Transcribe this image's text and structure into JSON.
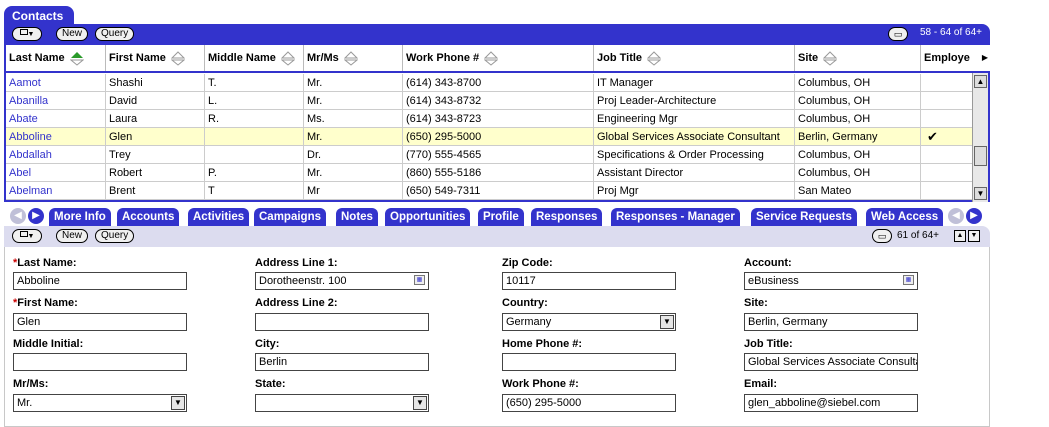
{
  "app": {
    "main_tab": "Contacts"
  },
  "list": {
    "new_label": "New",
    "query_label": "Query",
    "record_count": "58 - 64 of 64+",
    "columns": [
      "Last Name",
      "First Name",
      "Middle Name",
      "Mr/Ms",
      "Work Phone #",
      "Job Title",
      "Site",
      "Employe"
    ],
    "rows": [
      [
        "Aamot",
        "Shashi",
        "T.",
        "Mr.",
        "(614) 343-8700",
        "IT Manager",
        "Columbus, OH",
        ""
      ],
      [
        "Abanilla",
        "David",
        "L.",
        "Mr.",
        "(614) 343-8732",
        "Proj Leader-Architecture",
        "Columbus, OH",
        ""
      ],
      [
        "Abate",
        "Laura",
        "R.",
        "Ms.",
        "(614) 343-8723",
        "Engineering Mgr",
        "Columbus, OH",
        ""
      ],
      [
        "Abboline",
        "Glen",
        "",
        "Mr.",
        "(650) 295-5000",
        "Global Services Associate Consultant",
        "Berlin, Germany",
        "✔"
      ],
      [
        "Abdallah",
        "Trey",
        "",
        "Dr.",
        "(770) 555-4565",
        "Specifications & Order Processing",
        "Columbus, OH",
        ""
      ],
      [
        "Abel",
        "Robert",
        "P.",
        "Mr.",
        "(860) 555-5186",
        "Assistant Director",
        "Columbus, OH",
        ""
      ],
      [
        "Abelman",
        "Brent",
        "T",
        "Mr",
        "(650) 549-7311",
        "Proj Mgr",
        "San Mateo",
        ""
      ]
    ]
  },
  "tabs": [
    "More Info",
    "Accounts",
    "Activities",
    "Campaigns",
    "Notes",
    "Opportunities",
    "Profile",
    "Responses",
    "Responses - Manager",
    "Service Requests",
    "Web Access"
  ],
  "form": {
    "new_label": "New",
    "query_label": "Query",
    "record_count": "61 of 64+",
    "last_name_label": "Last Name:",
    "last_name": "Abboline",
    "first_name_label": "First Name:",
    "first_name": "Glen",
    "middle_initial_label": "Middle Initial:",
    "middle_initial": "",
    "mr_ms_label": "Mr/Ms:",
    "mr_ms": "Mr.",
    "address1_label": "Address Line 1:",
    "address1": "Dorotheenstr. 100",
    "address2_label": "Address Line 2:",
    "address2": "",
    "city_label": "City:",
    "city": "Berlin",
    "state_label": "State:",
    "state": "",
    "zip_label": "Zip Code:",
    "zip": "10117",
    "country_label": "Country:",
    "country": "Germany",
    "home_phone_label": "Home Phone #:",
    "home_phone": "",
    "work_phone_label": "Work Phone #:",
    "work_phone": "(650) 295-5000",
    "account_label": "Account:",
    "account": "eBusiness",
    "site_label": "Site:",
    "site": "Berlin, Germany",
    "job_title_label": "Job Title:",
    "job_title": "Global Services Associate Consultant",
    "email_label": "Email:",
    "email": "glen_abboline@siebel.com"
  },
  "colors": {
    "accent": "#3333cc",
    "selected_row": "#ffffcc",
    "link": "#3333cc"
  }
}
